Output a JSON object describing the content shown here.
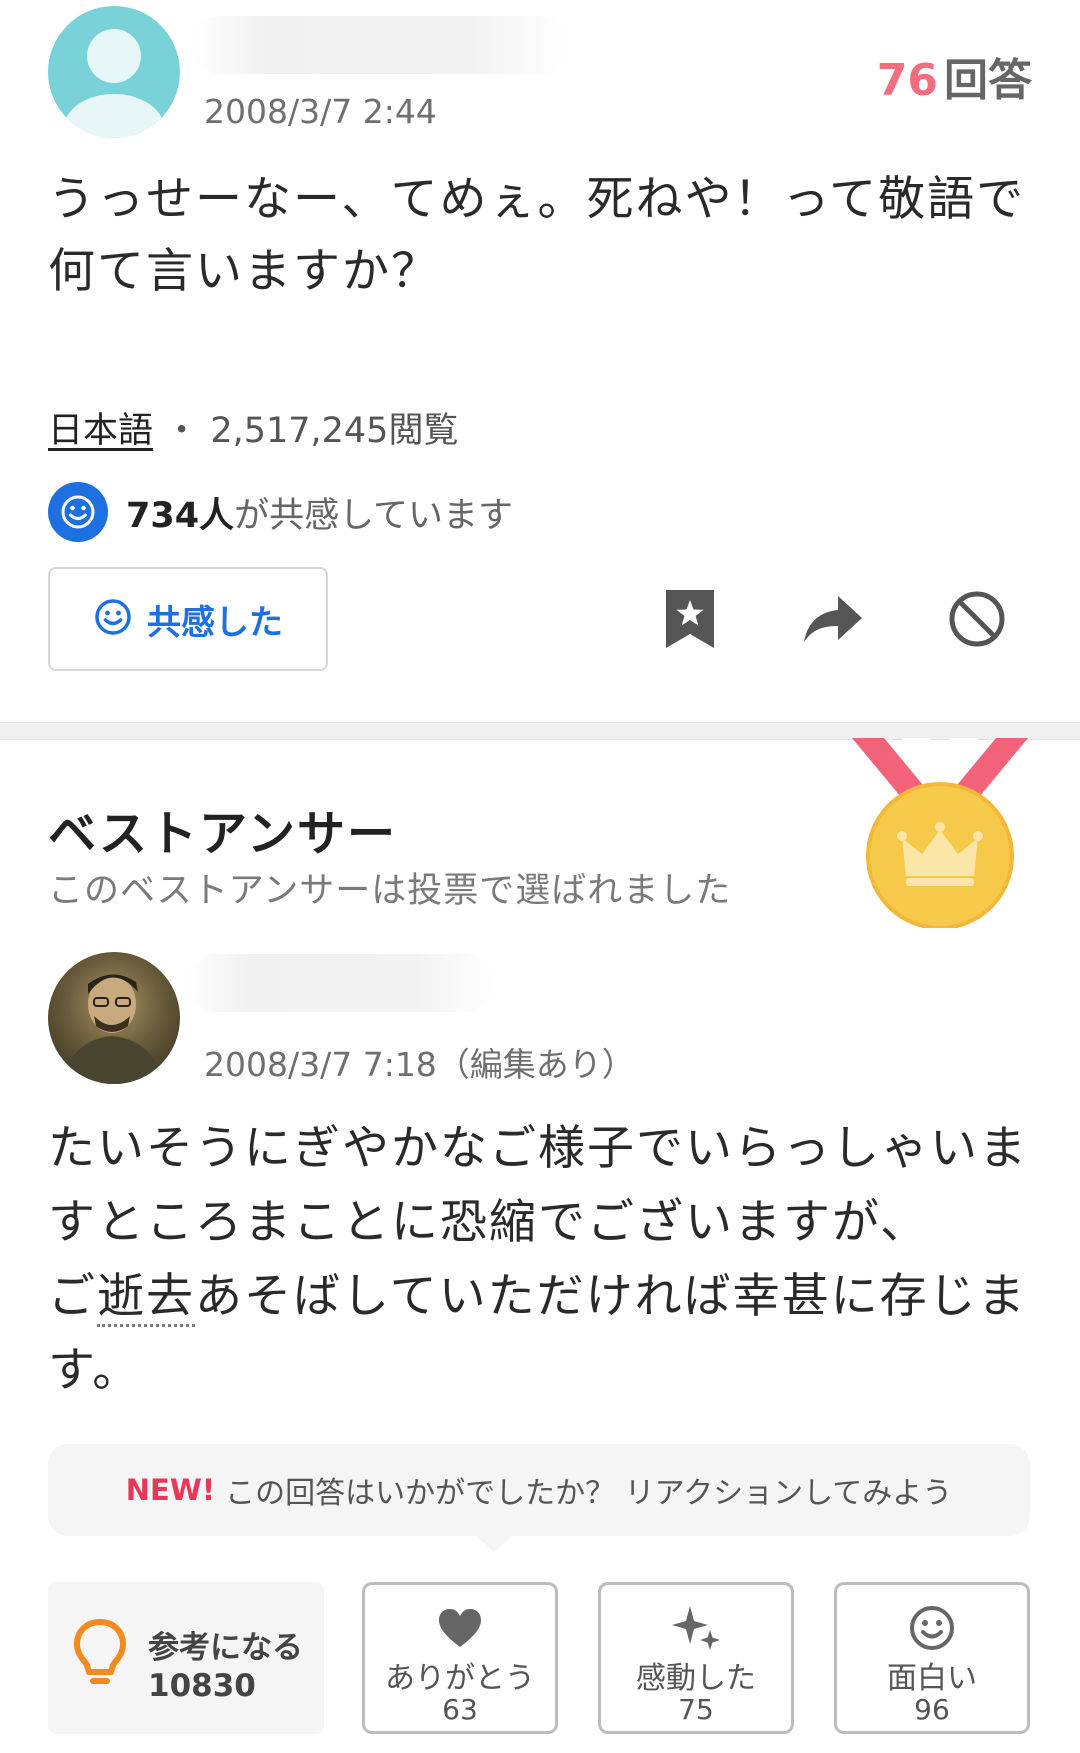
{
  "question": {
    "timestamp": "2008/3/7 2:44",
    "answer_count": "76",
    "answer_count_unit": "回答",
    "text_line1": "うっせーなー、てめぇ。死ねや！って敬語で",
    "text_line2": "何て言いますか？",
    "category": "日本語",
    "separator": "・",
    "views": "2,517,245閲覧",
    "empathy_count": "734人",
    "empathy_suffix": "が共感しています",
    "empathize_label": "共感した"
  },
  "best_answer": {
    "title": "ベストアンサー",
    "subtitle": "このベストアンサーは投票で選ばれました",
    "timestamp": "2008/3/7 7:18（編集あり）",
    "line1": "たいそうにぎやかなご様子でいらっしゃいま",
    "line2": "すところまことに恐縮でございますが、",
    "line3_pre": "ご",
    "line3_term": "逝去",
    "line3_post": "あそばしていただければ幸甚に存じま",
    "line4": "す。"
  },
  "reaction_prompt": {
    "new_label": "NEW!",
    "message": "この回答はいかがでしたか？ リアクションしてみよう"
  },
  "reactions": {
    "helpful": {
      "label": "参考になる",
      "count": "10830"
    },
    "thanks": {
      "label": "ありがとう",
      "count": "63"
    },
    "moved": {
      "label": "感動した",
      "count": "75"
    },
    "funny": {
      "label": "面白い",
      "count": "96"
    }
  },
  "colors": {
    "accent_blue": "#1e6fe0",
    "answer_count_pink": "#f26d7d",
    "new_red": "#e8385a",
    "medal_gold": "#f7c94a",
    "ribbon_pink": "#f2637a",
    "avatar_teal": "#79d2d7"
  },
  "icons": {
    "empathy": "smiley-icon",
    "bookmark": "bookmark-star-icon",
    "share": "share-arrow-icon",
    "block": "block-icon",
    "medal": "best-answer-medal-icon",
    "helpful": "lightbulb-icon",
    "thanks": "heart-icon",
    "moved": "sparkle-icon",
    "funny": "smiley-icon"
  }
}
